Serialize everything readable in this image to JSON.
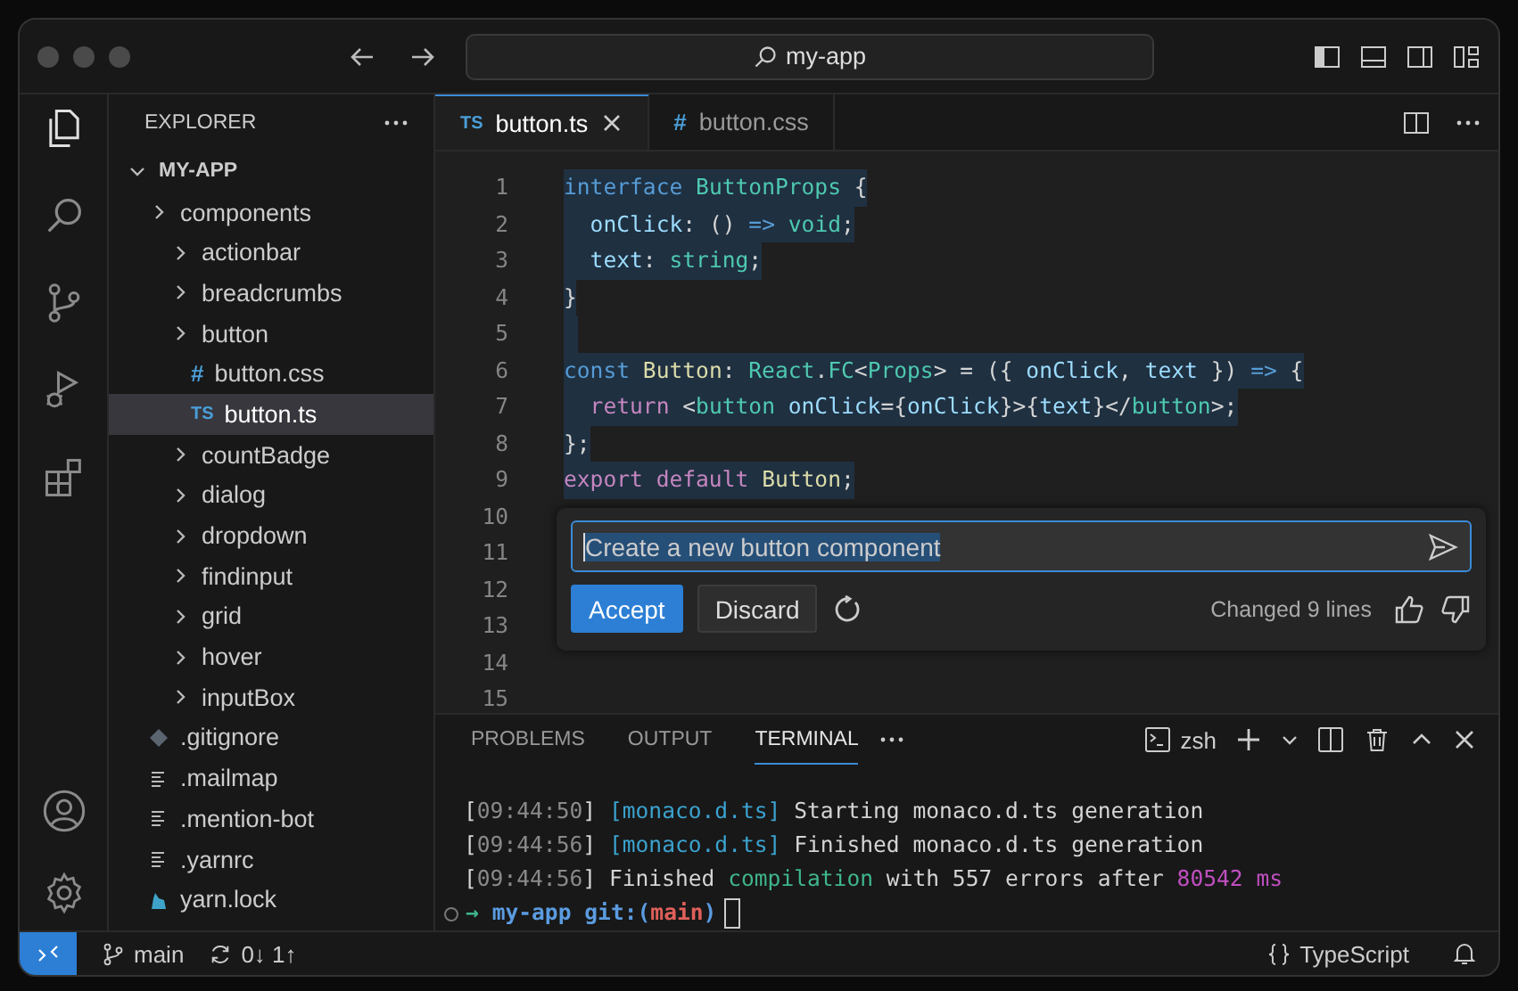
{
  "window": {
    "search": "my-app"
  },
  "sidebar": {
    "title": "EXPLORER",
    "tree": [
      {
        "label": "MY-APP",
        "kind": "root",
        "expanded": true,
        "children": [
          {
            "label": "components",
            "kind": "folder",
            "expanded": false,
            "children": [
              {
                "label": "actionbar",
                "kind": "folder",
                "expanded": false
              },
              {
                "label": "breadcrumbs",
                "kind": "folder",
                "expanded": false
              },
              {
                "label": "button",
                "kind": "folder",
                "expanded": false,
                "children": [
                  {
                    "label": "button.css",
                    "kind": "css",
                    "badge": "#",
                    "selected": false
                  },
                  {
                    "label": "button.ts",
                    "kind": "ts",
                    "badge": "TS",
                    "selected": true
                  }
                ]
              },
              {
                "label": "countBadge",
                "kind": "folder",
                "expanded": false
              },
              {
                "label": "dialog",
                "kind": "folder",
                "expanded": false
              },
              {
                "label": "dropdown",
                "kind": "folder",
                "expanded": false
              },
              {
                "label": "findinput",
                "kind": "folder",
                "expanded": false
              },
              {
                "label": "grid",
                "kind": "folder",
                "expanded": false
              },
              {
                "label": "hover",
                "kind": "folder",
                "expanded": false
              },
              {
                "label": "inputBox",
                "kind": "folder",
                "expanded": false
              }
            ]
          },
          {
            "label": ".gitignore",
            "kind": "git",
            "selected": false
          },
          {
            "label": ".mailmap",
            "kind": "text",
            "selected": false
          },
          {
            "label": ".mention-bot",
            "kind": "text",
            "selected": false
          },
          {
            "label": ".yarnrc",
            "kind": "text",
            "selected": false
          },
          {
            "label": "yarn.lock",
            "kind": "yarn",
            "selected": false
          }
        ]
      }
    ]
  },
  "tabs": [
    {
      "label": "button.ts",
      "kind": "ts",
      "badge": "TS",
      "selected": true
    },
    {
      "label": "button.css",
      "kind": "css",
      "badge": "#",
      "selected": false
    }
  ],
  "code": [
    {
      "number": "1",
      "highlighted": true,
      "tokens": [
        {
          "text": "interface ",
          "kind": "kw"
        },
        {
          "text": "ButtonProps",
          "kind": "type"
        },
        {
          "text": " {",
          "kind": "p"
        }
      ]
    },
    {
      "number": "2",
      "highlighted": true,
      "tokens": [
        {
          "text": "  onClick",
          "kind": "var"
        },
        {
          "text": ": () ",
          "kind": "p"
        },
        {
          "text": "=>",
          "kind": "kw"
        },
        {
          "text": " void",
          "kind": "type"
        },
        {
          "text": ";",
          "kind": "p"
        }
      ]
    },
    {
      "number": "3",
      "highlighted": true,
      "tokens": [
        {
          "text": "  text",
          "kind": "var"
        },
        {
          "text": ": ",
          "kind": "p"
        },
        {
          "text": "string",
          "kind": "type"
        },
        {
          "text": ";",
          "kind": "p"
        }
      ]
    },
    {
      "number": "4",
      "highlighted": true,
      "tokens": [
        {
          "text": "}",
          "kind": "p"
        }
      ]
    },
    {
      "number": "5",
      "highlighted": true
    },
    {
      "number": "6",
      "highlighted": true,
      "tokens": [
        {
          "text": "const ",
          "kind": "kw"
        },
        {
          "text": "Button",
          "kind": "fn"
        },
        {
          "text": ": ",
          "kind": "p"
        },
        {
          "text": "React",
          "kind": "type"
        },
        {
          "text": ".",
          "kind": "p"
        },
        {
          "text": "FC",
          "kind": "type"
        },
        {
          "text": "<",
          "kind": "p"
        },
        {
          "text": "Props",
          "kind": "type"
        },
        {
          "text": "> = ({ ",
          "kind": "p"
        },
        {
          "text": "onClick",
          "kind": "var"
        },
        {
          "text": ", ",
          "kind": "p"
        },
        {
          "text": "text",
          "kind": "var"
        },
        {
          "text": " }) ",
          "kind": "p"
        },
        {
          "text": "=>",
          "kind": "kw"
        },
        {
          "text": " {",
          "kind": "p"
        }
      ]
    },
    {
      "number": "7",
      "highlighted": true,
      "tokens": [
        {
          "text": "  return ",
          "kind": "ctrl"
        },
        {
          "text": "<",
          "kind": "p"
        },
        {
          "text": "button ",
          "kind": "type"
        },
        {
          "text": "onClick",
          "kind": "var"
        },
        {
          "text": "={",
          "kind": "p"
        },
        {
          "text": "onClick",
          "kind": "var"
        },
        {
          "text": "}>{",
          "kind": "p"
        },
        {
          "text": "text",
          "kind": "var"
        },
        {
          "text": "}</",
          "kind": "p"
        },
        {
          "text": "button",
          "kind": "type"
        },
        {
          "text": ">;",
          "kind": "p"
        }
      ]
    },
    {
      "number": "8",
      "highlighted": true,
      "tokens": [
        {
          "text": "};",
          "kind": "p"
        }
      ]
    },
    {
      "number": "9",
      "highlighted": true,
      "tokens": [
        {
          "text": "export default ",
          "kind": "ctrl"
        },
        {
          "text": "Button",
          "kind": "fn"
        },
        {
          "text": ";",
          "kind": "p"
        }
      ]
    }
  ],
  "empty_line_numbers": [
    "10",
    "11",
    "12",
    "13",
    "14",
    "15"
  ],
  "inline_chat": {
    "value": "Create a new button component",
    "buttons": [
      {
        "label": "Accept",
        "kind": "primary"
      },
      {
        "label": "Discard",
        "kind": "secondary"
      }
    ],
    "status": "Changed 9 lines"
  },
  "panel": {
    "tabs": [
      {
        "label": "PROBLEMS",
        "selected": false
      },
      {
        "label": "OUTPUT",
        "selected": false
      },
      {
        "label": "TERMINAL",
        "selected": true
      }
    ],
    "shell": "zsh",
    "lines": [
      [
        {
          "text": "[",
          "kind": "p"
        },
        {
          "text": "09:44:50",
          "kind": "dim"
        },
        {
          "text": "] ",
          "kind": "p"
        },
        {
          "text": "[monaco.d.ts]",
          "kind": "cyan"
        },
        {
          "text": " Starting monaco.d.ts generation",
          "kind": "p"
        }
      ],
      [
        {
          "text": "[",
          "kind": "p"
        },
        {
          "text": "09:44:56",
          "kind": "dim"
        },
        {
          "text": "] ",
          "kind": "p"
        },
        {
          "text": "[monaco.d.ts]",
          "kind": "cyan"
        },
        {
          "text": " Finished monaco.d.ts generation",
          "kind": "p"
        }
      ],
      [
        {
          "text": "[",
          "kind": "p"
        },
        {
          "text": "09:44:56",
          "kind": "dim"
        },
        {
          "text": "] Finished ",
          "kind": "p"
        },
        {
          "text": "compilation",
          "kind": "green"
        },
        {
          "text": " with 557 errors after ",
          "kind": "p"
        },
        {
          "text": "80542 ms",
          "kind": "magenta"
        }
      ]
    ],
    "prompt": [
      {
        "text": "→ ",
        "kind": "green"
      },
      {
        "text": "my-app ",
        "kind": "bluebold"
      },
      {
        "text": "git:(",
        "kind": "bluebold"
      },
      {
        "text": "main",
        "kind": "red"
      },
      {
        "text": ")",
        "kind": "bluebold"
      }
    ]
  },
  "status_bar": {
    "branch": "main",
    "sync": "0↓ 1↑",
    "language": "TypeScript"
  }
}
